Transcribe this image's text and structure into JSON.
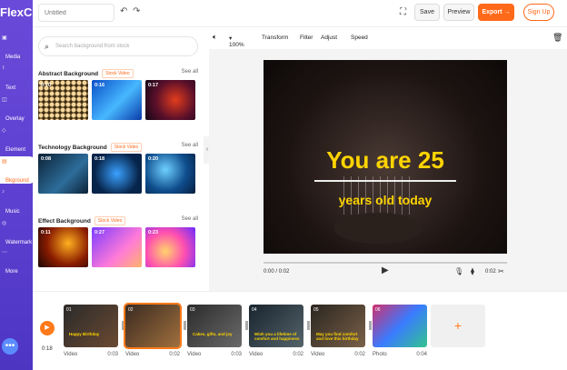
{
  "app": {
    "logo": "FlexClip"
  },
  "nav": {
    "items": [
      {
        "label": "Media",
        "icon": "media-icon"
      },
      {
        "label": "Text",
        "icon": "text-icon"
      },
      {
        "label": "Overlay",
        "icon": "overlay-icon"
      },
      {
        "label": "Element",
        "icon": "element-icon"
      },
      {
        "label": "Bkground",
        "icon": "background-icon"
      },
      {
        "label": "Music",
        "icon": "music-icon"
      },
      {
        "label": "Watermark",
        "icon": "watermark-icon"
      },
      {
        "label": "More",
        "icon": "more-icon"
      }
    ],
    "active_index": 4,
    "chat_icon": "chat-icon"
  },
  "topbar": {
    "title_placeholder": "Untitled",
    "save_label": "Save",
    "preview_label": "Preview",
    "export_label": "Export →",
    "signup_label": "Sign Up"
  },
  "panel": {
    "search_placeholder": "Search background from stock",
    "sections": [
      {
        "title": "Abstract Background",
        "tag": "Stock Video",
        "see_all": "See all",
        "thumbs": [
          {
            "time": "0:10"
          },
          {
            "time": "0:16"
          },
          {
            "time": "0:17"
          }
        ]
      },
      {
        "title": "Technology Background",
        "tag": "Stock Video",
        "see_all": "See all",
        "thumbs": [
          {
            "time": "0:08"
          },
          {
            "time": "0:18"
          },
          {
            "time": "0:20"
          }
        ]
      },
      {
        "title": "Effect Background",
        "tag": "Stock Video",
        "see_all": "See all",
        "thumbs": [
          {
            "time": "0:11"
          },
          {
            "time": "0:27"
          },
          {
            "time": "0:23"
          }
        ]
      }
    ]
  },
  "editor": {
    "volume_icon": "volume-icon",
    "zoom": "100%",
    "tools": [
      "Transform",
      "Filter",
      "Adjust",
      "Speed"
    ],
    "delete_icon": "trash-icon",
    "video_text": {
      "line1": "You are 25",
      "line2": "years old today"
    },
    "time_current": "0:00 / 0:02",
    "time_right": "0:02"
  },
  "timeline": {
    "total": "0:18",
    "clips": [
      {
        "num": "01",
        "caption": "Happy Birthday",
        "type": "Video",
        "duration": "0:03",
        "active": false
      },
      {
        "num": "02",
        "caption": "",
        "type": "Video",
        "duration": "0:02",
        "active": true
      },
      {
        "num": "03",
        "caption": "Cakes, gifts, and joy",
        "type": "Video",
        "duration": "0:03",
        "active": false
      },
      {
        "num": "04",
        "caption": "Wish you a lifetime of comfort and happiness",
        "type": "Video",
        "duration": "0:02",
        "active": false
      },
      {
        "num": "05",
        "caption": "May you find comfort and love this birthday",
        "type": "Video",
        "duration": "0:02",
        "active": false
      },
      {
        "num": "06",
        "caption": "",
        "type": "Photo",
        "duration": "0:04",
        "active": false
      }
    ],
    "add_label": "+"
  }
}
